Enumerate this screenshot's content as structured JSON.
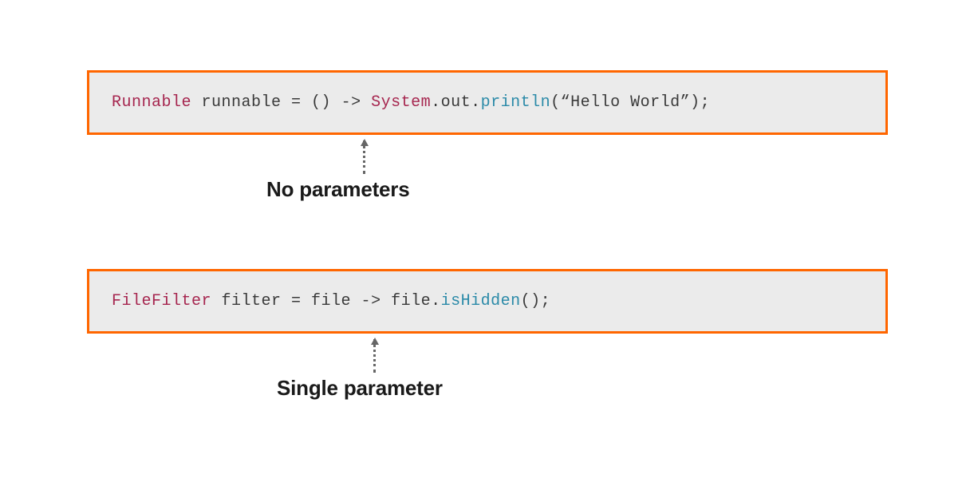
{
  "box1": {
    "t_type": "Runnable",
    "t_var": " runnable = ",
    "t_params": "()",
    "t_arrow": " -> ",
    "t_sys": "System",
    "t_dot1": ".out.",
    "t_method": "println",
    "t_open": "(",
    "t_str": "“Hello World”",
    "t_close": ");"
  },
  "annotation1": "No parameters",
  "box2": {
    "t_type": "FileFilter",
    "t_mid": " filter = file -> file.",
    "t_method": "isHidden",
    "t_end": "();"
  },
  "annotation2": "Single parameter"
}
